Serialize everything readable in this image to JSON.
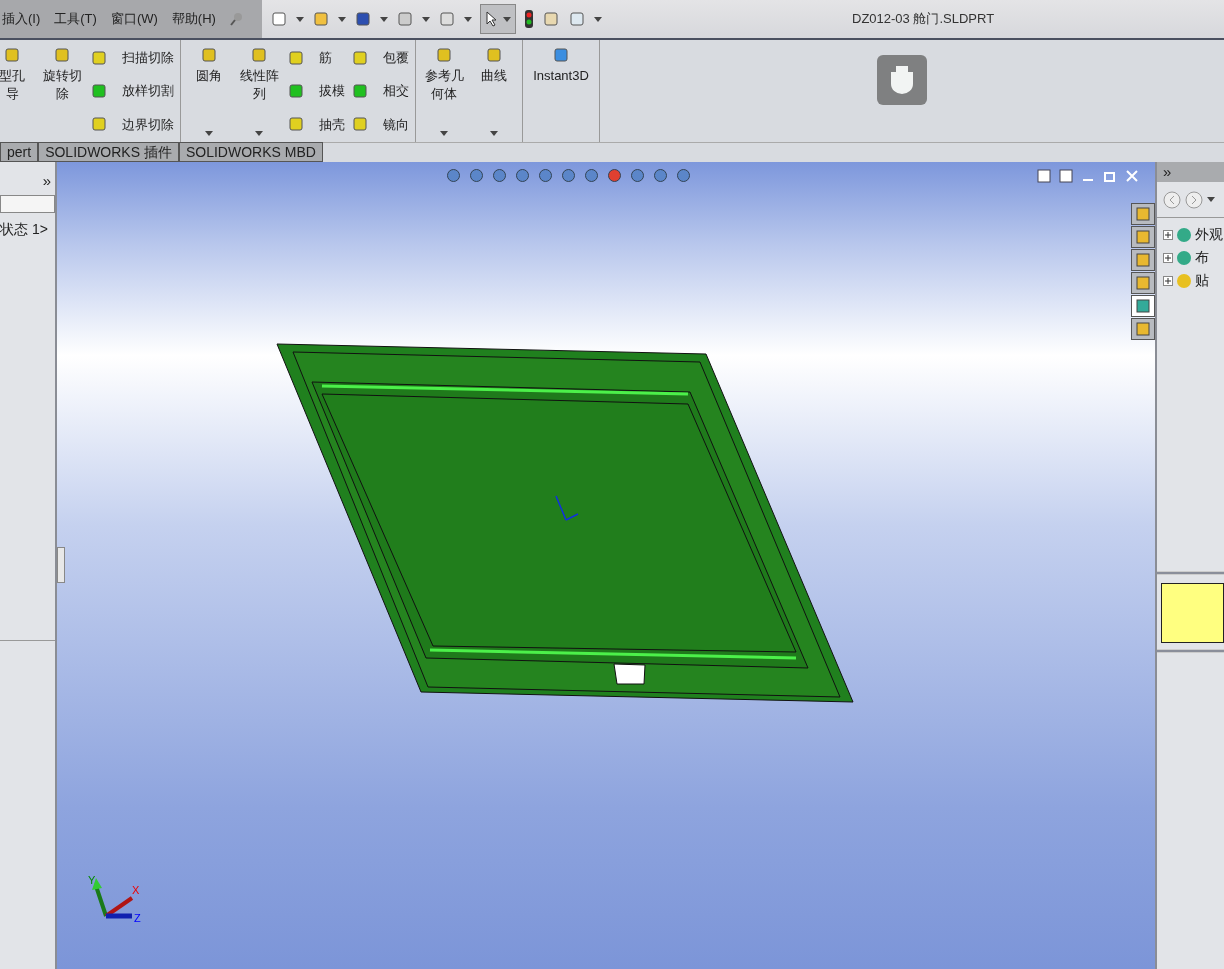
{
  "menu": [
    "插入(I)",
    "工具(T)",
    "窗口(W)",
    "帮助(H)"
  ],
  "window": {
    "title": "DZ012-03 舱门.SLDPRT"
  },
  "ribbon": {
    "groups": [
      {
        "items": [
          {
            "kind": "large",
            "lines": [
              "型孔",
              "导"
            ],
            "dropdown": false
          },
          {
            "kind": "large",
            "lines": [
              "旋转切",
              "除"
            ],
            "dropdown": false
          },
          {
            "kind": "stack",
            "labels": [
              "扫描切除",
              "放样切割",
              "边界切除"
            ]
          }
        ]
      },
      {
        "items": [
          {
            "kind": "large",
            "lines": [
              "圆角"
            ],
            "dropdown": true
          },
          {
            "kind": "large",
            "lines": [
              "线性阵",
              "列"
            ],
            "dropdown": true
          },
          {
            "kind": "stack",
            "labels": [
              "筋",
              "拔模",
              "抽壳"
            ]
          },
          {
            "kind": "stack",
            "labels": [
              "包覆",
              "相交",
              "镜向"
            ]
          }
        ]
      },
      {
        "items": [
          {
            "kind": "large",
            "lines": [
              "参考几",
              "何体"
            ],
            "dropdown": true
          },
          {
            "kind": "large",
            "lines": [
              "曲线"
            ],
            "dropdown": true
          }
        ]
      },
      {
        "items": [
          {
            "kind": "wide",
            "lines": [
              "Instant3D"
            ],
            "dropdown": false
          }
        ]
      }
    ]
  },
  "tabs": [
    {
      "label": "pert"
    },
    {
      "label": "SOLIDWORKS 插件"
    },
    {
      "label": "SOLIDWORKS MBD"
    }
  ],
  "left_panel": {
    "expand": "»",
    "tree_item": "状态 1>"
  },
  "viewport": {
    "triad": {
      "x": "X",
      "y": "Y",
      "z": "Z"
    }
  },
  "task_pane": {
    "expand": "»",
    "tabs": [
      {
        "selected": false
      },
      {
        "selected": false
      },
      {
        "selected": false
      },
      {
        "selected": false
      },
      {
        "selected": true
      },
      {
        "selected": false
      }
    ],
    "tree": [
      {
        "label": "外观"
      },
      {
        "label": "布"
      },
      {
        "label": "贴"
      }
    ]
  }
}
